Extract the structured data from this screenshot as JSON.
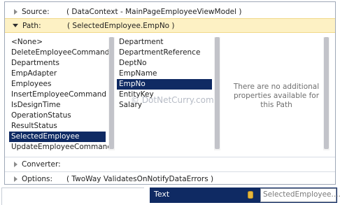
{
  "sections": {
    "source": {
      "label": "Source:",
      "value": "( DataContext - MainPageEmployeeViewModel )"
    },
    "path": {
      "label": "Path:",
      "value": "( SelectedEmployee.EmpNo )"
    },
    "converter": {
      "label": "Converter:"
    },
    "options": {
      "label": "Options:",
      "value": "( TwoWay ValidatesOnNotifyDataErrors )"
    }
  },
  "col1": {
    "items": [
      "<None>",
      "DeleteEmployeeCommand",
      "Departments",
      "EmpAdapter",
      "Employees",
      "InsertEmployeeCommand",
      "IsDesignTime",
      "OperationStatus",
      "ResultStatus",
      "SelectedEmployee",
      "UpdateEmployeeCommand"
    ],
    "selected_index": 9
  },
  "col2": {
    "items": [
      "Department",
      "DepartmentReference",
      "DeptNo",
      "EmpName",
      "EmpNo",
      "EntityKey",
      "Salary"
    ],
    "selected_index": 4
  },
  "col3": {
    "message": "There are no additional properties available for this Path"
  },
  "watermark": "© DotNetCurry.com",
  "property_row": {
    "name": "Text",
    "icon": "database-icon",
    "value": "SelectedEmployee...."
  },
  "colors": {
    "selection": "#0f2a63",
    "path_highlight": "#fdf1c4"
  }
}
